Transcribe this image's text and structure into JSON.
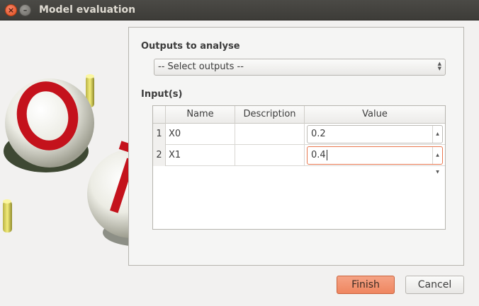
{
  "window": {
    "title": "Model evaluation",
    "close_glyph": "×",
    "minimize_glyph": "–"
  },
  "outputs_section": {
    "label": "Outputs to analyse",
    "select_value": "-- Select outputs --"
  },
  "inputs_section": {
    "label": "Input(s)",
    "columns": [
      "Name",
      "Description",
      "Value"
    ],
    "rows": [
      {
        "index": "1",
        "name": "X0",
        "description": "",
        "value": "0.2"
      },
      {
        "index": "2",
        "name": "X1",
        "description": "",
        "value": "0.4"
      }
    ]
  },
  "buttons": {
    "finish_label": "Finish",
    "cancel_label": "Cancel"
  },
  "colors": {
    "accent": "#ef8660",
    "titlebar": "#3d3c38"
  }
}
